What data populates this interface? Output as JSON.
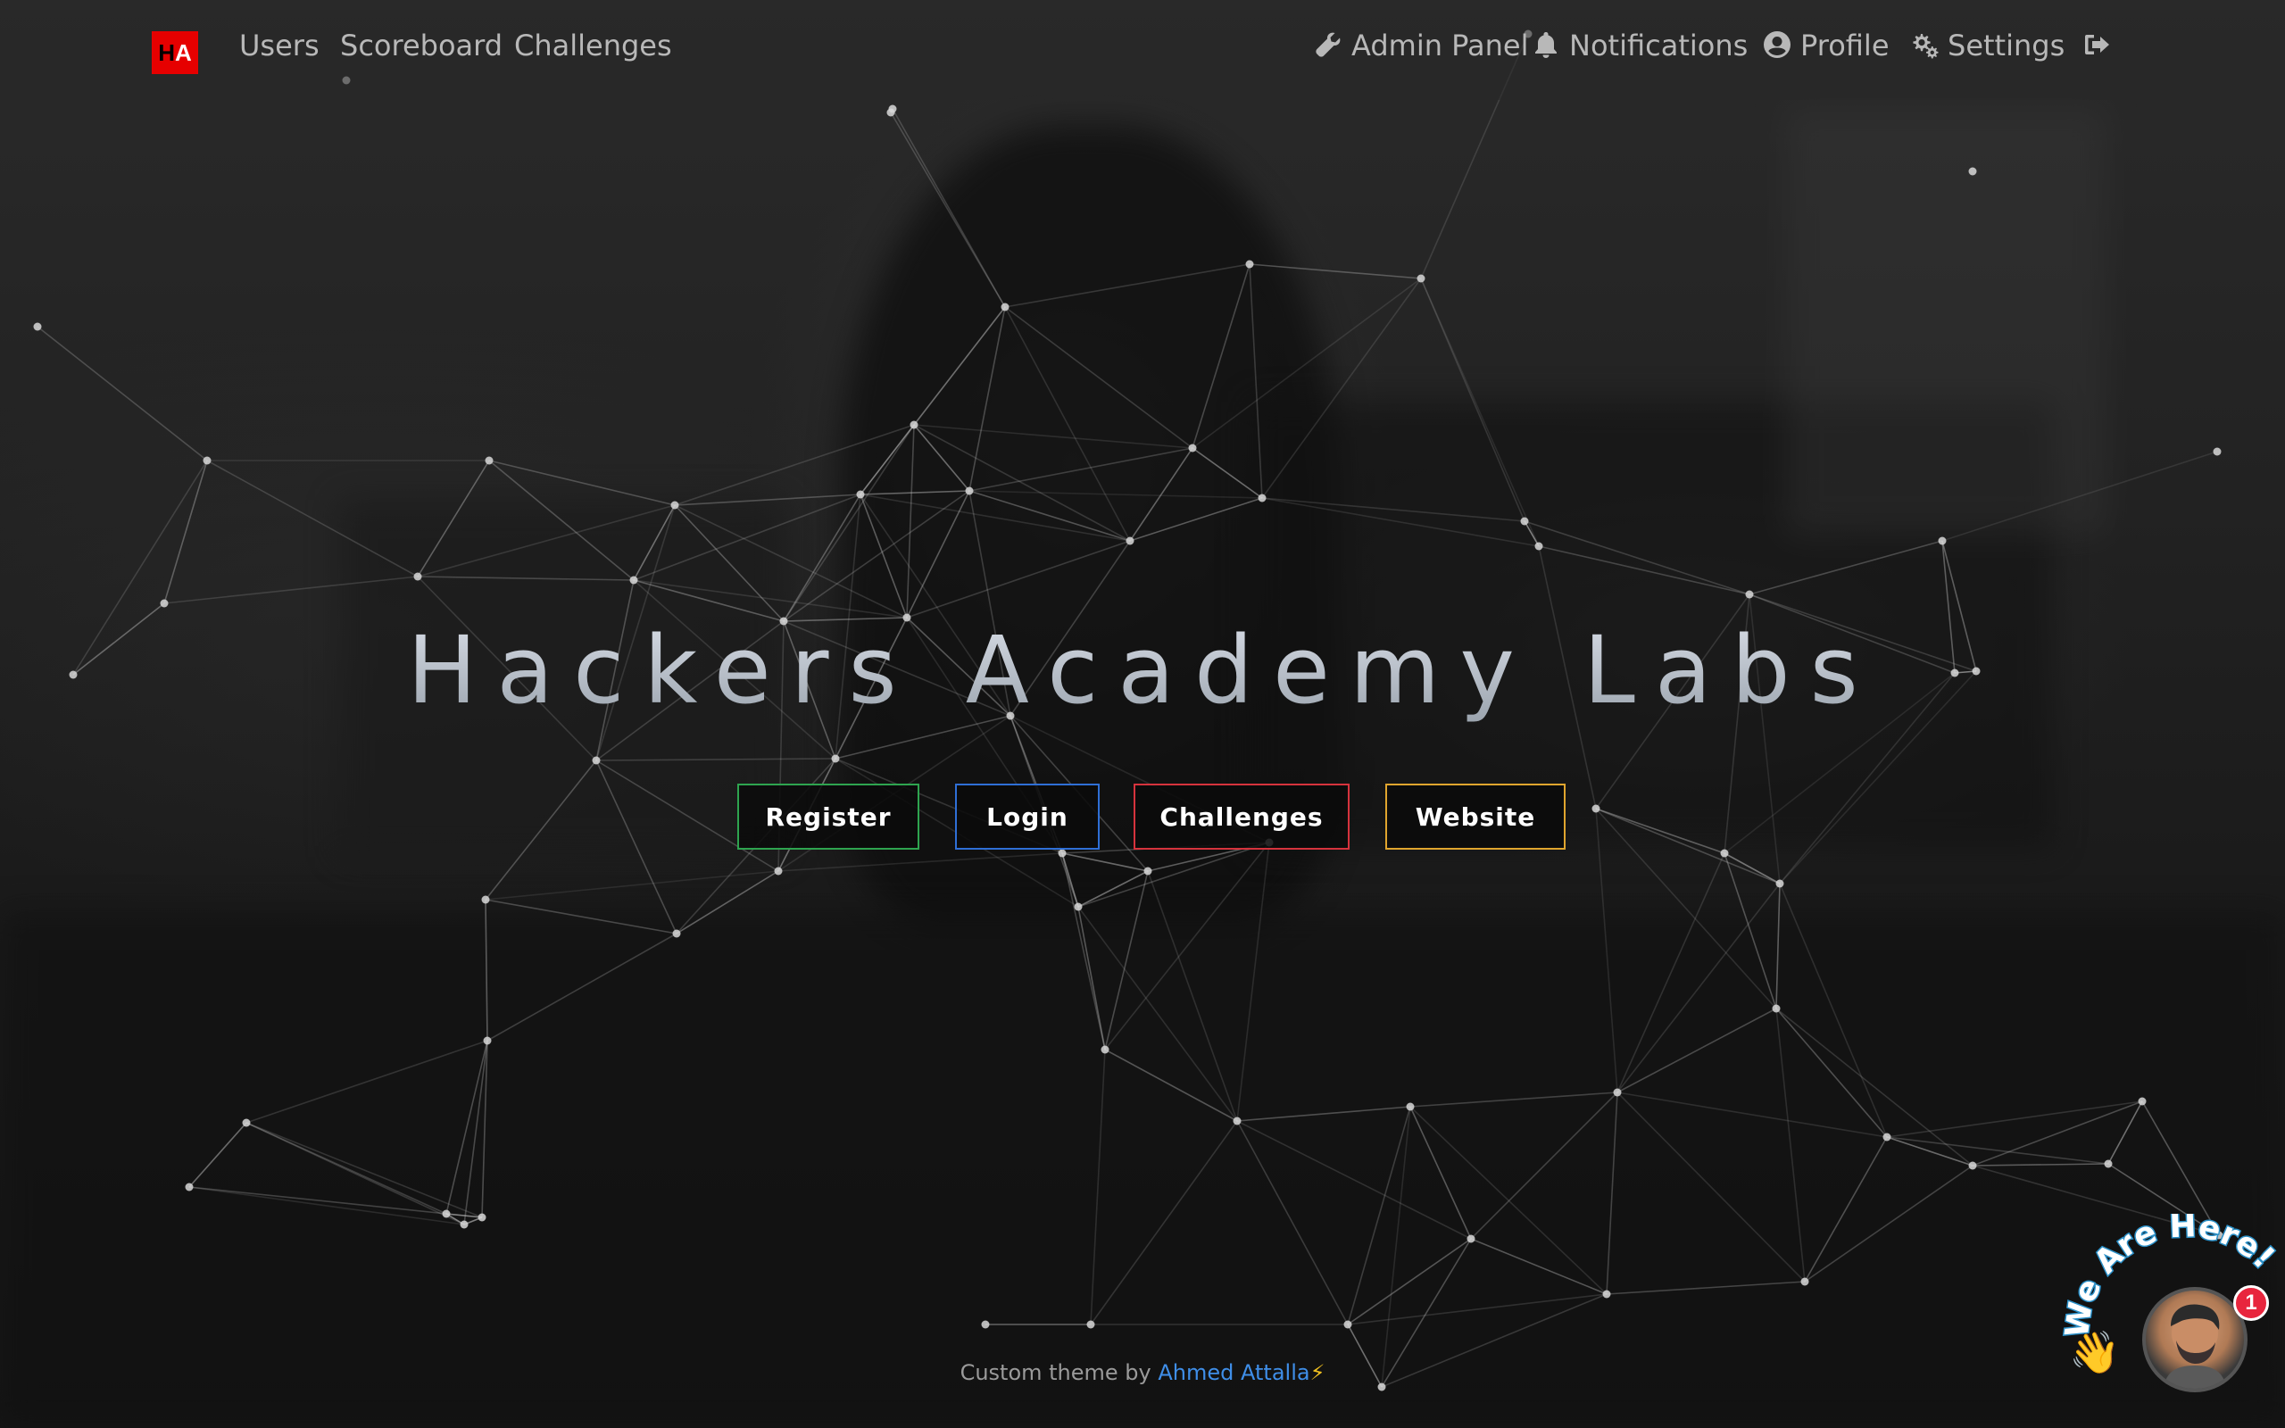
{
  "navbar": {
    "logo_h": "H",
    "logo_a": "A",
    "left_links": [
      {
        "label": "Users"
      },
      {
        "label": "Scoreboard"
      },
      {
        "label": "Challenges"
      }
    ],
    "right_links": [
      {
        "label": "Admin Panel",
        "icon": "wrench-icon"
      },
      {
        "label": "Notifications",
        "icon": "bell-icon"
      },
      {
        "label": "Profile",
        "icon": "user-circle-icon"
      },
      {
        "label": "Settings",
        "icon": "gears-icon"
      }
    ],
    "logout_icon": "sign-out-icon"
  },
  "hero": {
    "title": "Hackers Academy Labs",
    "buttons": [
      {
        "label": "Register",
        "color": "#2ea44f"
      },
      {
        "label": "Login",
        "color": "#2f6fd6"
      },
      {
        "label": "Challenges",
        "color": "#d6333d"
      },
      {
        "label": "Website",
        "color": "#e0a52e"
      }
    ]
  },
  "footer": {
    "prefix": "Custom theme by",
    "author": "Ahmed Attalla",
    "suffix_icon": "lightning-icon"
  },
  "chat_widget": {
    "greeting": "We Are Here!",
    "badge_count": "1",
    "wave_icon": "waving-hand-icon"
  },
  "colors": {
    "brand_red": "#e60000",
    "link_blue": "#3f8ee8",
    "nav_text": "#b8b8b8"
  }
}
